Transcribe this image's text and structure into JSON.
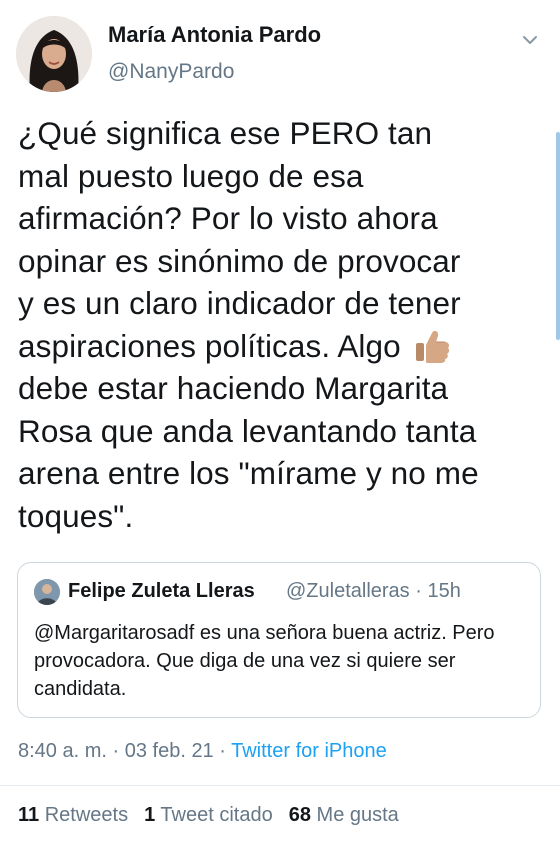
{
  "author": {
    "name": "María Antonia Pardo",
    "handle": "@NanyPardo",
    "avatar_icon": "profile-photo"
  },
  "tweet": {
    "text_before_emoji": "¿Qué significa ese PERO tan\nmal puesto luego de esa\nafirmación? Por lo visto ahora\nopinar es sinónimo de provocar\ny es un claro indicador de tener\naspiraciones políticas. Algo ",
    "emoji_icon": "thumbs-up-icon",
    "text_after_emoji": "\ndebe estar haciendo Margarita\nRosa que anda levantando tanta\narena entre los \"mírame y no me\ntoques\"."
  },
  "quoted_tweet": {
    "name": "Felipe Zuleta Lleras",
    "handle_time": "@Zuletalleras · 15h",
    "text": "@Margaritarosadf es una señora buena actriz. Pero provocadora. Que diga de una vez si quiere ser candidata."
  },
  "meta": {
    "time": "8:40 a. m.",
    "sep1": " · ",
    "date": "03 feb. 21",
    "sep2": " · ",
    "source": "Twitter for iPhone"
  },
  "stats": {
    "retweets_count": "11",
    "retweets_label": "Retweets",
    "quotes_count": "1",
    "quotes_label": "Tweet citado",
    "likes_count": "68",
    "likes_label": "Me gusta"
  },
  "colors": {
    "link": "#1da1f2",
    "secondary": "#657786",
    "text": "#14171a",
    "border": "#ccd6dd"
  }
}
